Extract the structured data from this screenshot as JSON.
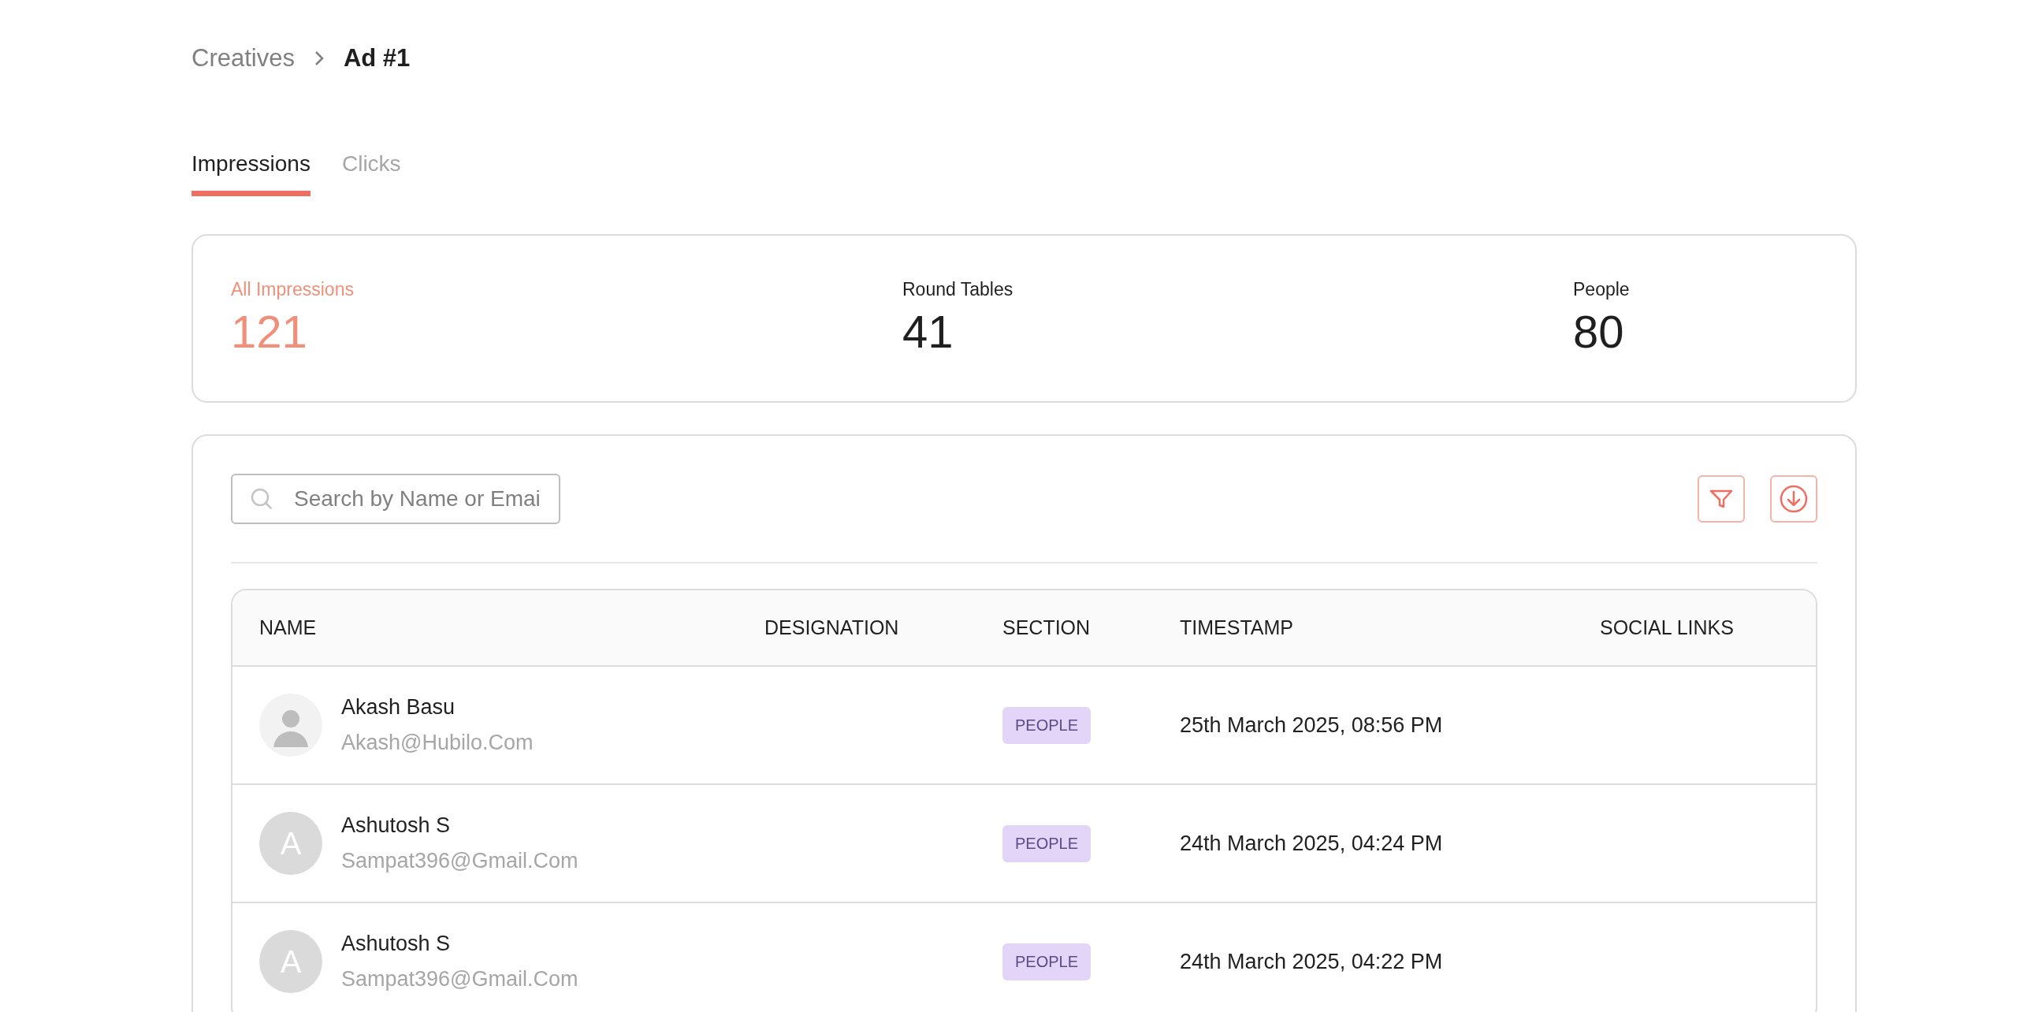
{
  "breadcrumb": [
    {
      "label": "Creatives",
      "current": false
    },
    {
      "label": "Ad #1",
      "current": true
    }
  ],
  "tabs": [
    {
      "label": "Impressions",
      "selected": true
    },
    {
      "label": "Clicks",
      "selected": false
    }
  ],
  "stats": [
    {
      "label": "All Impressions",
      "value": "121",
      "selected": true
    },
    {
      "label": "Round Tables",
      "value": "41",
      "selected": false
    },
    {
      "label": "People",
      "value": "80",
      "selected": false
    }
  ],
  "search": {
    "placeholder": "Search by Name or Emai"
  },
  "table": {
    "columns": [
      "NAME",
      "DESIGNATION",
      "SECTION",
      "TIMESTAMP",
      "SOCIAL LINKS"
    ],
    "rows": [
      {
        "avatar": {
          "kind": "photo"
        },
        "name": "Akash Basu",
        "email": "Akash@Hubilo.Com",
        "section": "PEOPLE",
        "timestamp": "25th March 2025, 08:56 PM"
      },
      {
        "avatar": {
          "kind": "initial",
          "initial": "A"
        },
        "name": "Ashutosh S",
        "email": "Sampat396@Gmail.Com",
        "section": "PEOPLE",
        "timestamp": "24th March 2025, 04:24 PM"
      },
      {
        "avatar": {
          "kind": "initial",
          "initial": "A"
        },
        "name": "Ashutosh S",
        "email": "Sampat396@Gmail.Com",
        "section": "PEOPLE",
        "timestamp": "24th March 2025, 04:22 PM"
      }
    ]
  }
}
